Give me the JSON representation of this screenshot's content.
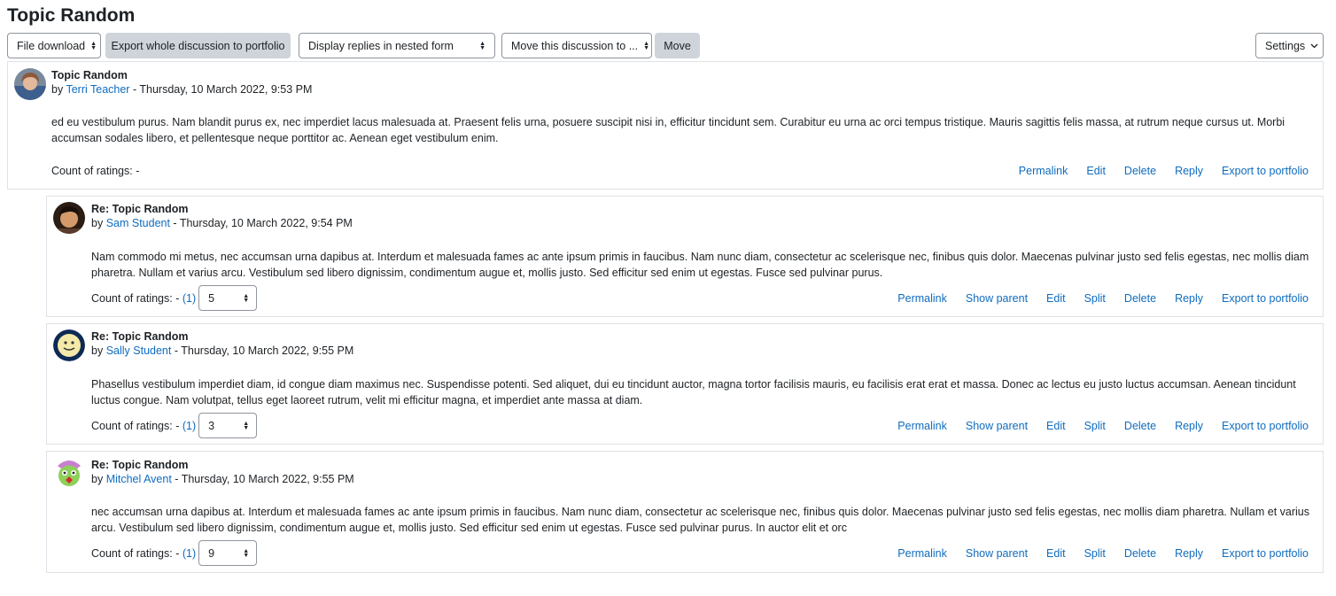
{
  "page_title": "Topic Random",
  "toolbar": {
    "file_download": "File download",
    "export_whole": "Export whole discussion to portfolio",
    "display_mode": "Display replies in nested form",
    "move_to": "Move this discussion to ...",
    "move_button": "Move",
    "settings": "Settings"
  },
  "icons": {
    "select_arrows": "▲▼",
    "chevron_down": "⌄"
  },
  "posts": [
    {
      "subject": "Topic Random",
      "by": "by",
      "author": "Terri Teacher",
      "date": " - Thursday, 10 March 2022, 9:53 PM",
      "body": "ed eu vestibulum purus. Nam blandit purus ex, nec imperdiet lacus malesuada at. Praesent felis urna, posuere suscipit nisi in, efficitur tincidunt sem. Curabitur eu urna ac orci tempus tristique. Mauris sagittis felis massa, at rutrum neque cursus ut. Morbi accumsan sodales libero, et pellentesque neque porttitor ac. Aenean eget vestibulum enim.",
      "ratings_label": "Count of ratings: -",
      "actions": [
        "Permalink",
        "Edit",
        "Delete",
        "Reply",
        "Export to portfolio"
      ]
    },
    {
      "subject": "Re: Topic Random",
      "by": "by",
      "author": "Sam Student",
      "date": " - Thursday, 10 March 2022, 9:54 PM",
      "body": "Nam commodo mi metus, nec accumsan urna dapibus at. Interdum et malesuada fames ac ante ipsum primis in faucibus. Nam nunc diam, consectetur ac scelerisque nec, finibus quis dolor. Maecenas pulvinar justo sed felis egestas, nec mollis diam pharetra. Nullam et varius arcu. Vestibulum sed libero dignissim, condimentum augue et, mollis justo. Sed efficitur sed enim ut egestas. Fusce sed pulvinar purus.",
      "ratings_label": "Count of ratings: -",
      "ratings_count": "(1)",
      "rating_value": "5",
      "actions": [
        "Permalink",
        "Show parent",
        "Edit",
        "Split",
        "Delete",
        "Reply",
        "Export to portfolio"
      ]
    },
    {
      "subject": "Re: Topic Random",
      "by": "by",
      "author": "Sally Student",
      "date": " - Thursday, 10 March 2022, 9:55 PM",
      "body": "Phasellus vestibulum imperdiet diam, id congue diam maximus nec. Suspendisse potenti. Sed aliquet, dui eu tincidunt auctor, magna tortor facilisis mauris, eu facilisis erat erat et massa. Donec ac lectus eu justo luctus accumsan. Aenean tincidunt luctus congue. Nam volutpat, tellus eget laoreet rutrum, velit mi efficitur magna, et imperdiet ante massa at diam.",
      "ratings_label": "Count of ratings: -",
      "ratings_count": "(1)",
      "rating_value": "3",
      "actions": [
        "Permalink",
        "Show parent",
        "Edit",
        "Split",
        "Delete",
        "Reply",
        "Export to portfolio"
      ]
    },
    {
      "subject": "Re: Topic Random",
      "by": "by",
      "author": "Mitchel Avent",
      "date": " - Thursday, 10 March 2022, 9:55 PM",
      "body": "nec accumsan urna dapibus at. Interdum et malesuada fames ac ante ipsum primis in faucibus. Nam nunc diam, consectetur ac scelerisque nec, finibus quis dolor. Maecenas pulvinar justo sed felis egestas, nec mollis diam pharetra. Nullam et varius arcu. Vestibulum sed libero dignissim, condimentum augue et, mollis justo. Sed efficitur sed enim ut egestas. Fusce sed pulvinar purus. In auctor elit et orc",
      "ratings_label": "Count of ratings: -",
      "ratings_count": "(1)",
      "rating_value": "9",
      "actions": [
        "Permalink",
        "Show parent",
        "Edit",
        "Split",
        "Delete",
        "Reply",
        "Export to portfolio"
      ]
    }
  ],
  "colors": {
    "link": "#0f6cbf",
    "button_grey": "#ced4da",
    "border": "#dee2e6"
  }
}
